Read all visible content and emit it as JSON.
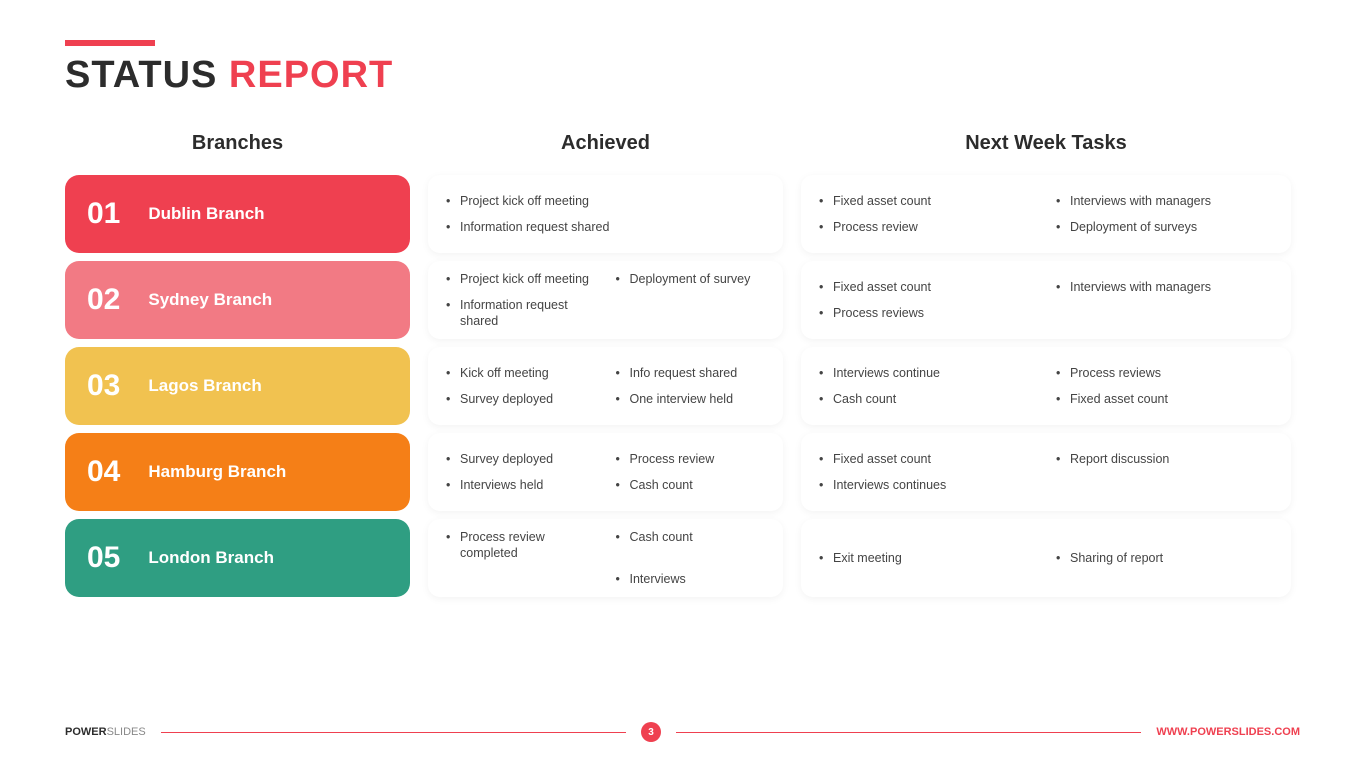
{
  "title": {
    "part1": "STATUS ",
    "part2": "REPORT"
  },
  "headers": {
    "branches": "Branches",
    "achieved": "Achieved",
    "next": "Next Week Tasks"
  },
  "rows": [
    {
      "num": "01",
      "name": "Dublin Branch",
      "color": "#ef4050",
      "achieved": [
        "Project kick off meeting",
        "Information request shared"
      ],
      "achievedCols": 1,
      "next": [
        "Fixed asset count",
        "Interviews with managers",
        "Process review",
        "Deployment of surveys"
      ]
    },
    {
      "num": "02",
      "name": "Sydney Branch",
      "color": "#f27a84",
      "achieved": [
        "Project kick off meeting",
        "Deployment of survey",
        "Information request shared"
      ],
      "achievedCols": 2,
      "next": [
        "Fixed asset count",
        "Interviews with managers",
        "Process reviews"
      ]
    },
    {
      "num": "03",
      "name": "Lagos Branch",
      "color": "#f1c250",
      "achieved": [
        "Kick off meeting",
        "Info request shared",
        "Survey deployed",
        "One interview held"
      ],
      "achievedCols": 2,
      "next": [
        "Interviews continue",
        "Process reviews",
        "Cash count",
        "Fixed asset count"
      ]
    },
    {
      "num": "04",
      "name": "Hamburg Branch",
      "color": "#f57f17",
      "achieved": [
        "Survey deployed",
        "Process review",
        "Interviews held",
        "Cash count"
      ],
      "achievedCols": 2,
      "next": [
        "Fixed asset count",
        "Report discussion",
        "Interviews continues"
      ]
    },
    {
      "num": "05",
      "name": "London Branch",
      "color": "#2f9e82",
      "achieved": [
        "Process review completed",
        "Cash count",
        "",
        "Interviews"
      ],
      "achievedCols": 2,
      "next": [
        "Exit meeting",
        "Sharing of report"
      ]
    }
  ],
  "footer": {
    "brand1": "POWER",
    "brand2": "SLIDES",
    "page": "3",
    "url": "WWW.POWERSLIDES.COM"
  }
}
